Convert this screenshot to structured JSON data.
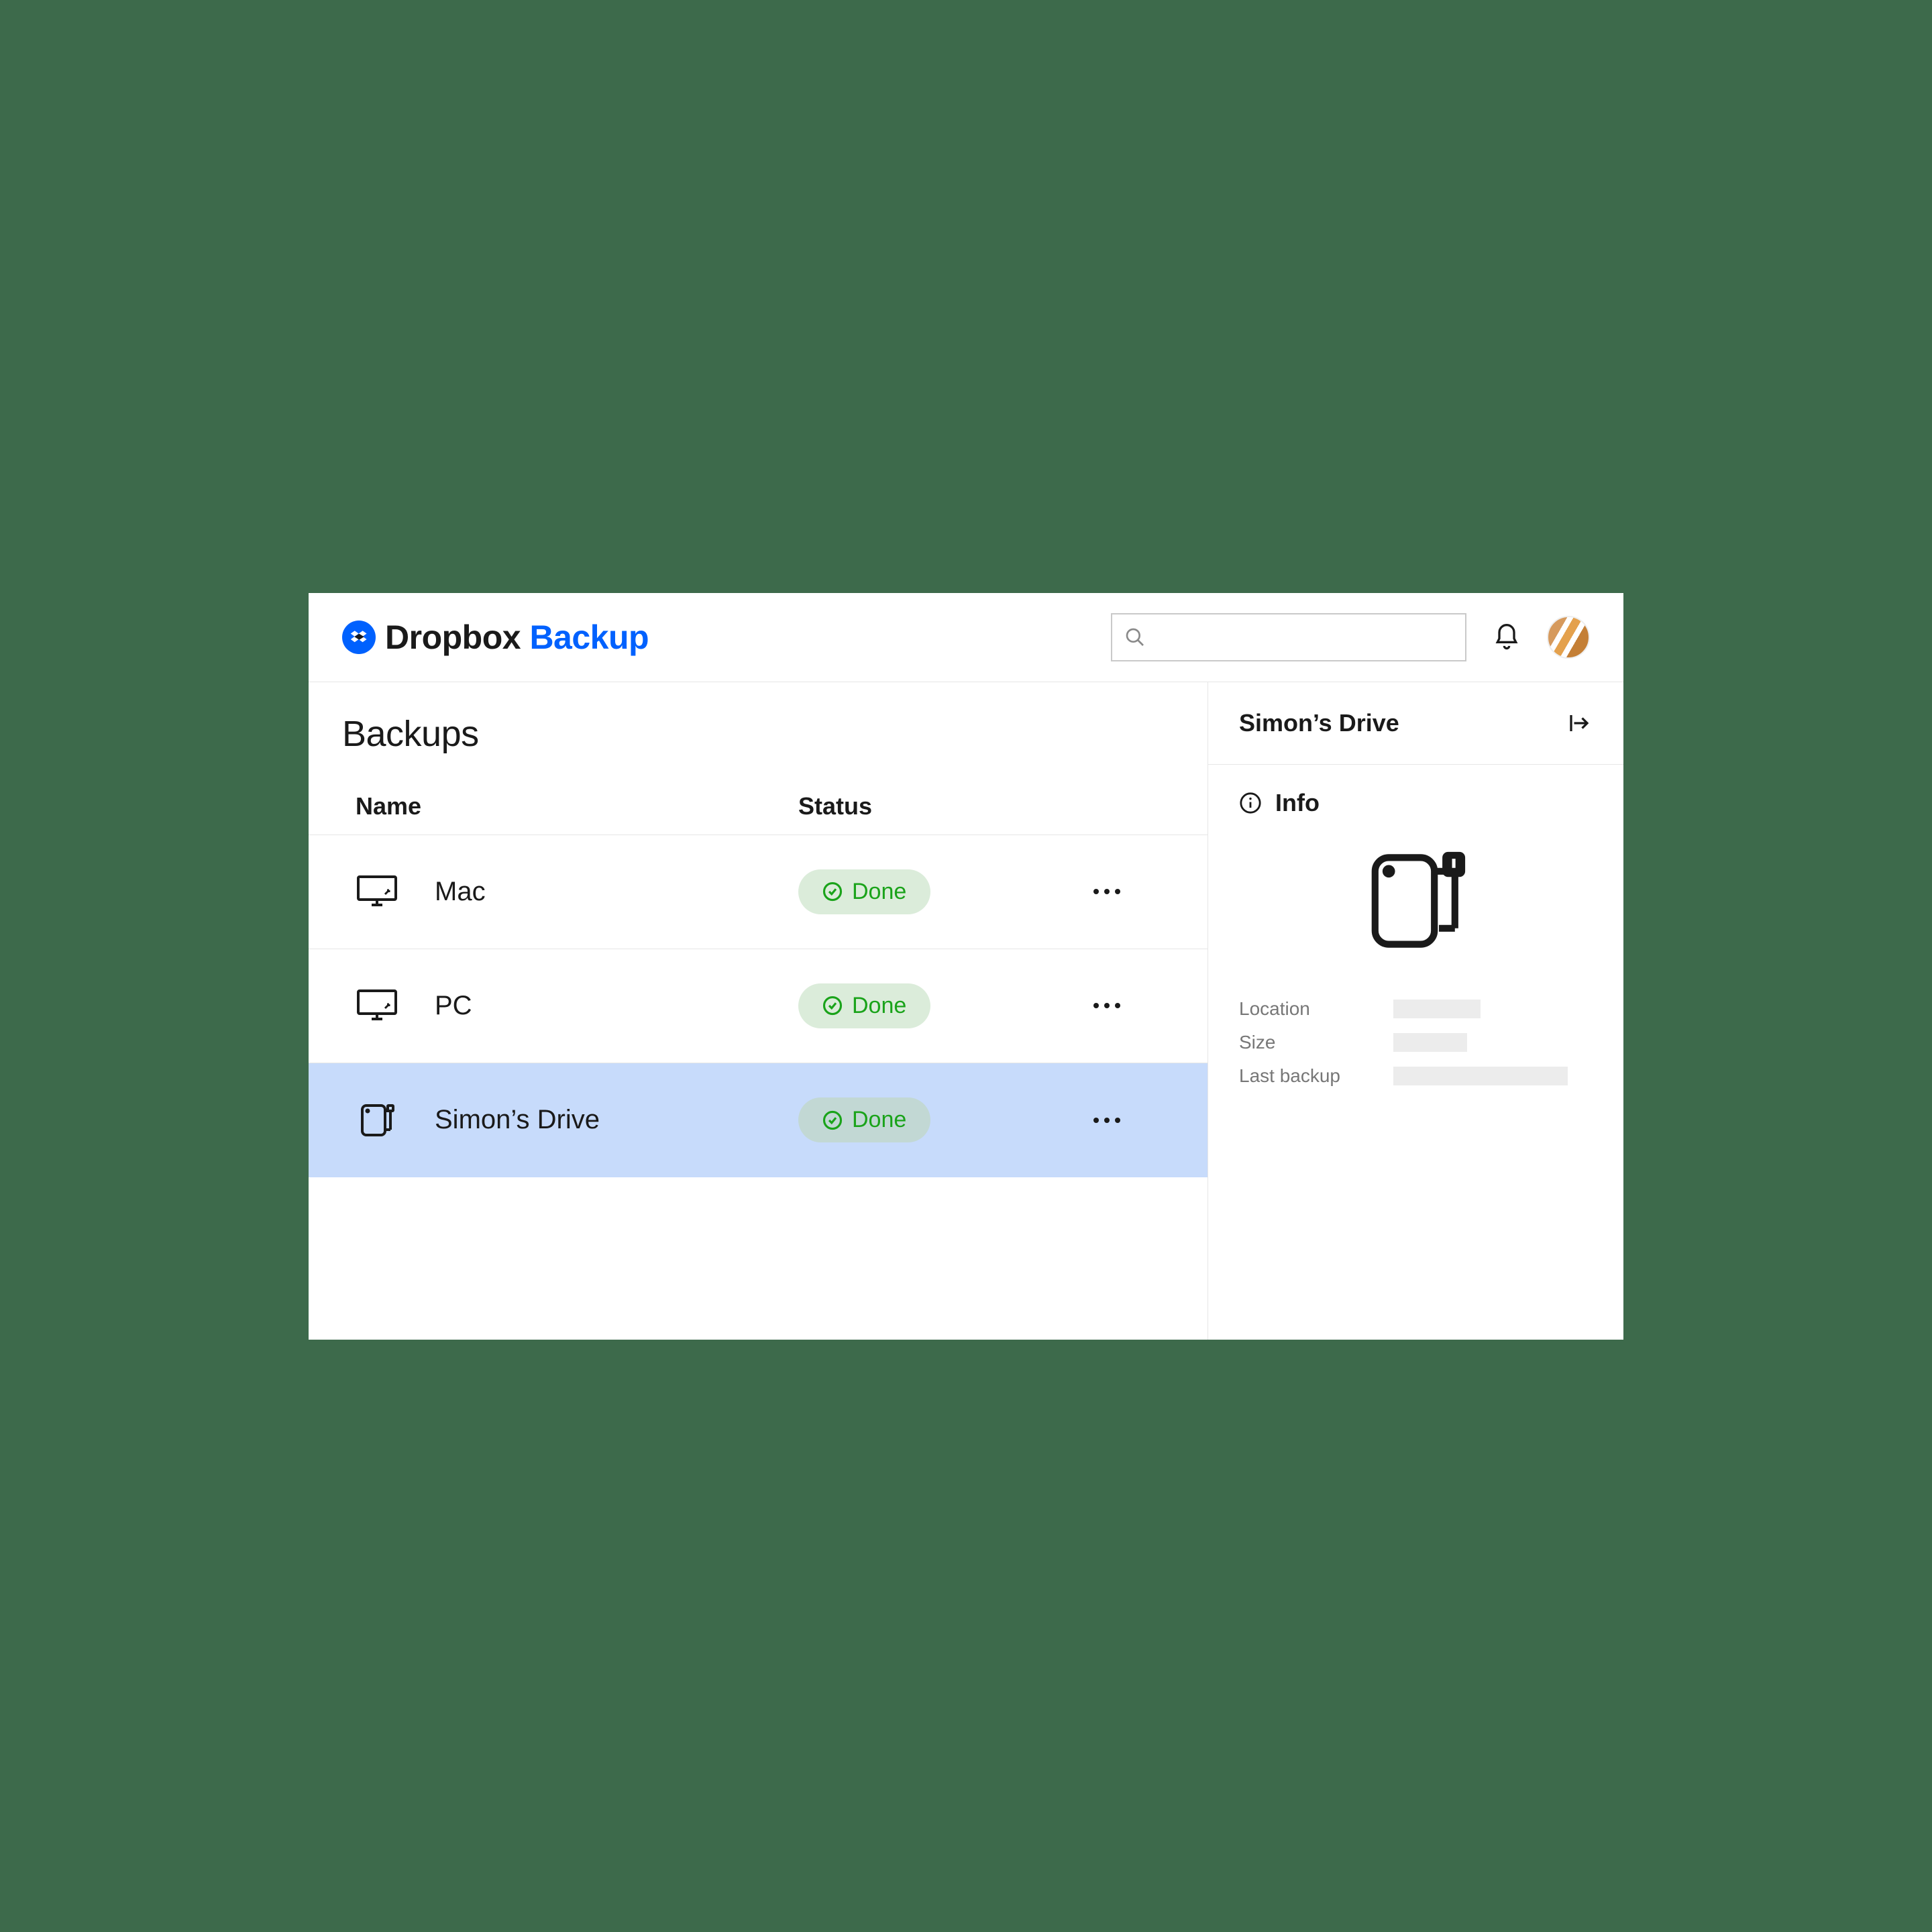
{
  "brand": {
    "name1": "Dropbox",
    "name2": "Backup"
  },
  "search": {
    "placeholder": ""
  },
  "page": {
    "title": "Backups"
  },
  "columns": {
    "name": "Name",
    "status": "Status"
  },
  "rows": [
    {
      "icon": "monitor-icon",
      "name": "Mac",
      "status": "Done",
      "selected": false
    },
    {
      "icon": "monitor-icon",
      "name": "PC",
      "status": "Done",
      "selected": false
    },
    {
      "icon": "drive-icon",
      "name": "Simon’s Drive",
      "status": "Done",
      "selected": true
    }
  ],
  "panel": {
    "title": "Simon’s Drive",
    "section": "Info",
    "fields": [
      {
        "label": "Location"
      },
      {
        "label": "Size"
      },
      {
        "label": "Last backup"
      }
    ]
  }
}
